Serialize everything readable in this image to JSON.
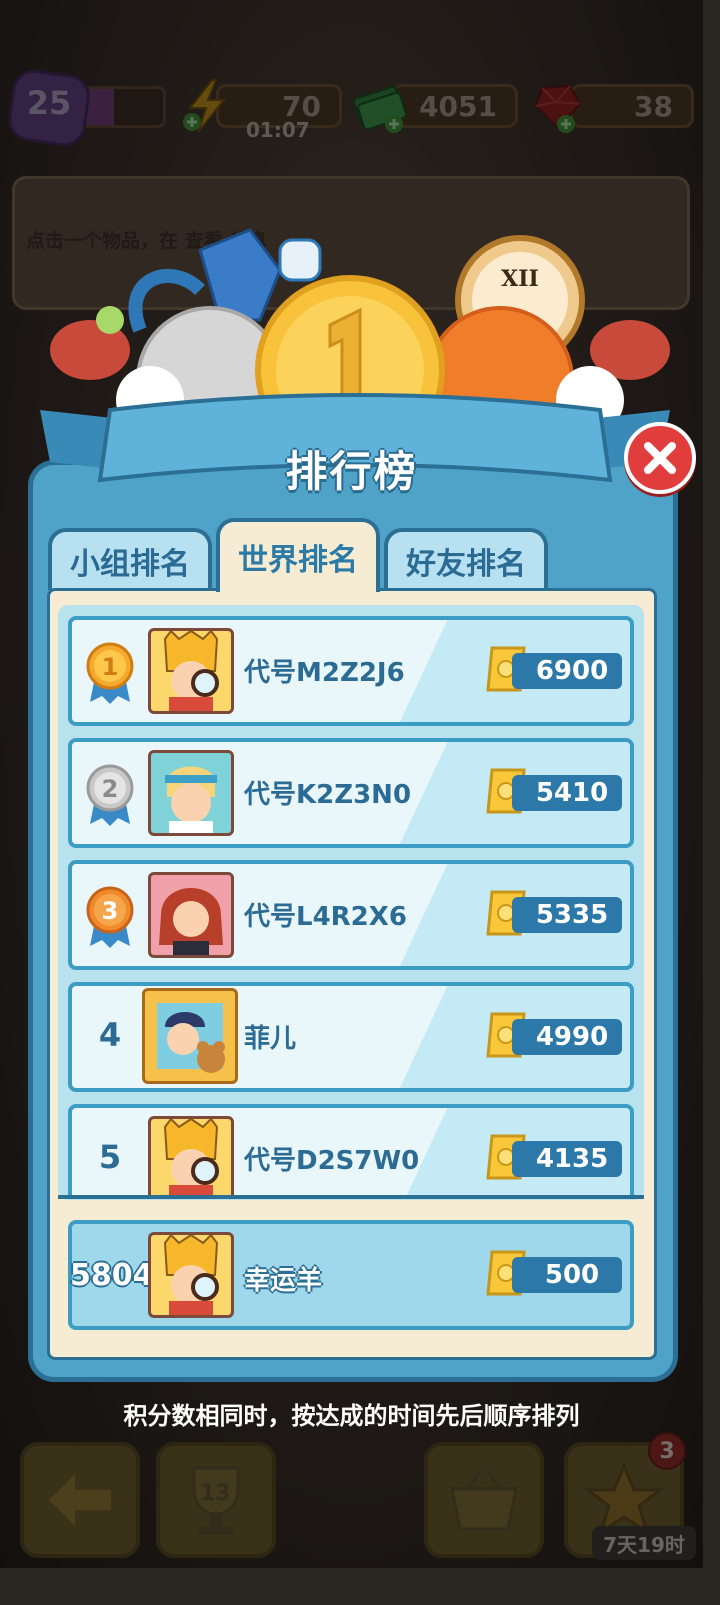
{
  "top_bar": {
    "level": "25",
    "level_progress": 0.45,
    "energy": "70",
    "energy_timer": "01:07",
    "cash": "4051",
    "gems": "38"
  },
  "info_panel": {
    "text": "点击一个物品，在 查看 信息"
  },
  "modal": {
    "title": "排行榜",
    "tabs": [
      {
        "label": "小组排名",
        "active": false
      },
      {
        "label": "世界排名",
        "active": true
      },
      {
        "label": "好友排名",
        "active": false
      }
    ],
    "rows": [
      {
        "rank": "1",
        "name": "代号M2Z2J6",
        "score": "6900",
        "avatar": "detective-yellow-hat"
      },
      {
        "rank": "2",
        "name": "代号K2Z3N0",
        "score": "5410",
        "avatar": "blonde-headband"
      },
      {
        "rank": "3",
        "name": "代号L4R2X6",
        "score": "5335",
        "avatar": "red-hair"
      },
      {
        "rank": "4",
        "name": "菲儿",
        "score": "4990",
        "avatar": "bear-frame"
      },
      {
        "rank": "5",
        "name": "代号D2S7W0",
        "score": "4135",
        "avatar": "detective-yellow-hat"
      }
    ],
    "my_row": {
      "rank": "5804",
      "name": "幸运羊",
      "score": "500"
    },
    "footer_note": "积分数相同时，按达成的时间先后顺序排列"
  },
  "bottom_nav": {
    "cup_count": "13",
    "badge_count": "3",
    "timer": "7天19时"
  },
  "colors": {
    "frame_blue": "#4fa2c8",
    "dark_blue": "#2b6f95",
    "cream": "#f6ecd3",
    "score_blue": "#2c78a8",
    "close_red": "#e23d3d",
    "gold": "#f4b73a"
  }
}
